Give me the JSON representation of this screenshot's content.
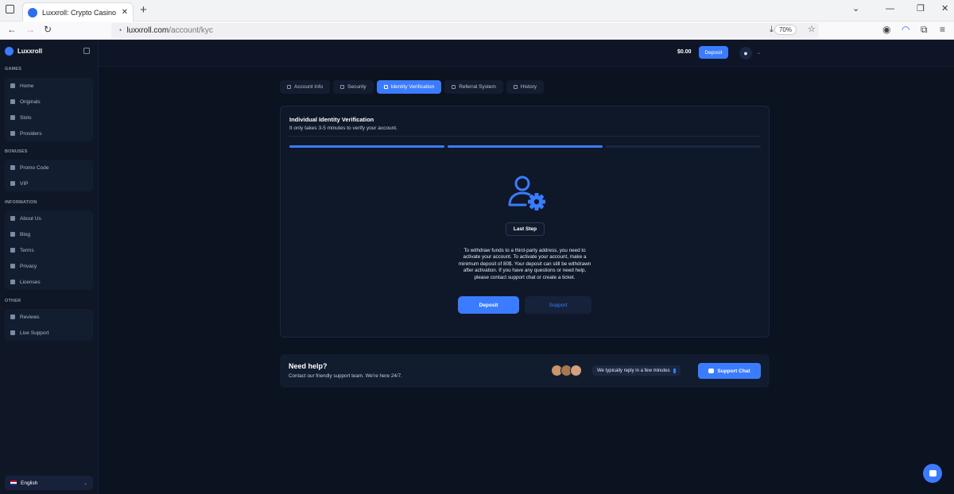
{
  "browser": {
    "tab_title": "Luxxroll: Crypto Casino Games",
    "url_host": "luxxroll.com",
    "url_path": "/account/kyc",
    "zoom": "70%"
  },
  "sidebar": {
    "brand": "Luxxroll",
    "sections": [
      {
        "label": "GAMES",
        "items": [
          {
            "label": "Home",
            "icon": "home-icon"
          },
          {
            "label": "Originals",
            "icon": "flame-icon"
          },
          {
            "label": "Slots",
            "icon": "slots-icon"
          },
          {
            "label": "Providers",
            "icon": "grid-icon"
          }
        ]
      },
      {
        "label": "BONUSES",
        "items": [
          {
            "label": "Promo Code",
            "icon": "ticket-icon"
          },
          {
            "label": "VIP",
            "icon": "crown-icon"
          }
        ]
      },
      {
        "label": "INFORMATION",
        "items": [
          {
            "label": "About Us",
            "icon": "info-icon"
          },
          {
            "label": "Blog",
            "icon": "blog-icon"
          },
          {
            "label": "Terms",
            "icon": "document-icon"
          },
          {
            "label": "Privacy",
            "icon": "lock-icon"
          },
          {
            "label": "Licenses",
            "icon": "license-icon"
          }
        ]
      },
      {
        "label": "OTHER",
        "items": [
          {
            "label": "Reviews",
            "icon": "chat-icon"
          },
          {
            "label": "Live Support",
            "icon": "headset-icon"
          }
        ]
      }
    ],
    "language": "English"
  },
  "header": {
    "balance": "$0.00",
    "deposit_label": "Deposit"
  },
  "tabs": [
    {
      "label": "Account Info",
      "active": false
    },
    {
      "label": "Security",
      "active": false
    },
    {
      "label": "Identity Verification",
      "active": true
    },
    {
      "label": "Referral System",
      "active": false
    },
    {
      "label": "History",
      "active": false
    }
  ],
  "kyc": {
    "title": "Individual Identity Verification",
    "subtitle": "It only takes 3-5 minutes to verify your account.",
    "progress_steps_done": 2,
    "progress_steps_total": 3,
    "step_badge": "Last Step",
    "description": "To withdraw funds to a third-party address, you need to activate your account. To activate your account, make a minimum deposit of 80$. Your deposit can still be withdrawn after activation. If you have any questions or need help, please contact support chat or create a ticket.",
    "deposit_button": "Deposit",
    "support_button": "Support"
  },
  "help": {
    "title": "Need help?",
    "subtitle": "Contact our friendly support team. We're here 24/7.",
    "reply_note": "We typically reply in a few minutes",
    "support_chat": "Support Chat"
  },
  "colors": {
    "accent": "#3b7cff",
    "background": "#0b1220",
    "panel": "#0f1829"
  }
}
